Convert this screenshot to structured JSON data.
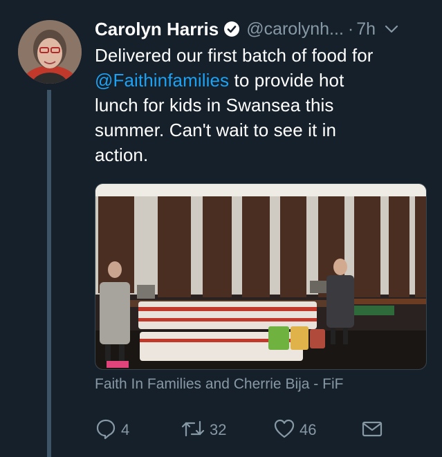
{
  "tweet": {
    "display_name": "Carolyn Harris",
    "handle": "@carolynh...",
    "separator": "·",
    "time": "7h",
    "text_line_1": "Delivered our first batch of food for",
    "mention": "@Faithinfamilies",
    "text_line_2_rest": " to provide hot",
    "text_line_3": "lunch for kids in Swansea this",
    "text_line_4": "summer. Can't wait to see it in",
    "text_line_5": "action.",
    "media_caption": "Faith In Families and Cherrie Bija - FiF"
  },
  "actions": {
    "reply_count": "4",
    "retweet_count": "32",
    "like_count": "46"
  },
  "colors": {
    "background": "#15202b",
    "text": "#ffffff",
    "secondary": "#8899a6",
    "link": "#1da1f2",
    "thread_line": "#3d5466"
  },
  "icons": [
    "verified-badge-icon",
    "chevron-down-icon",
    "reply-icon",
    "retweet-icon",
    "like-icon",
    "share-icon"
  ]
}
